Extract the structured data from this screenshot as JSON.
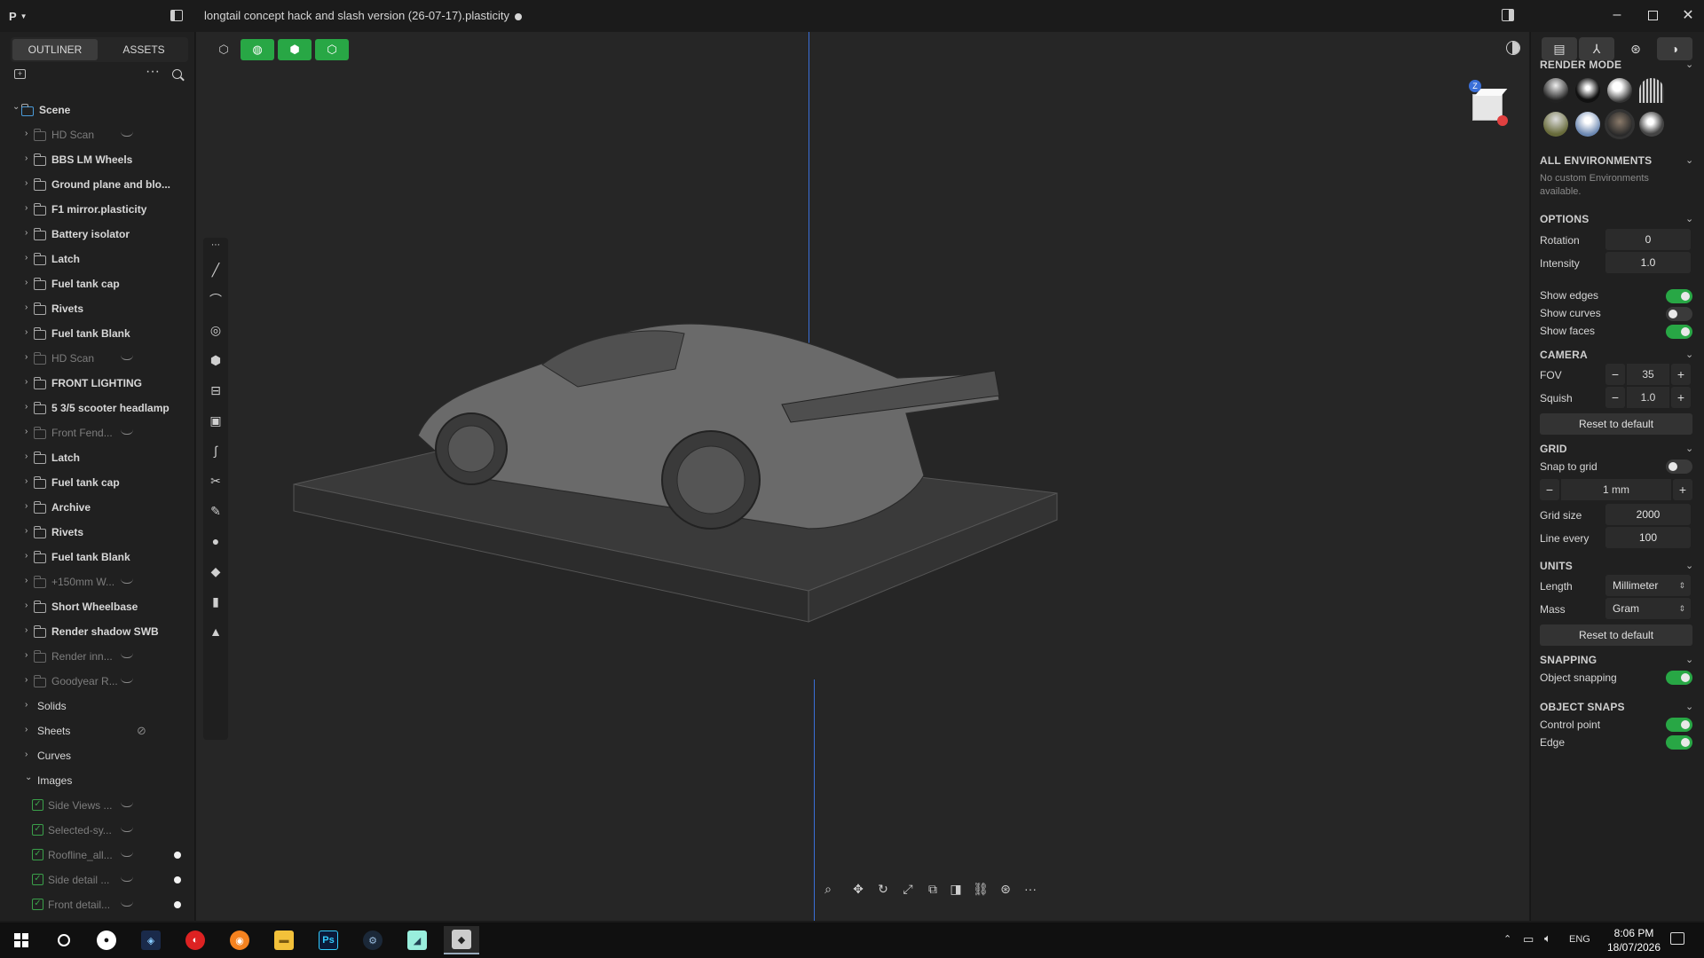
{
  "app": {
    "title": "longtail concept hack and slash version (26-07-17).plasticity",
    "menu_glyph": "P"
  },
  "outliner": {
    "tabs": [
      "OUTLINER",
      "ASSETS"
    ],
    "active_tab": "OUTLINER",
    "items": [
      {
        "label": "Scene",
        "level": 0,
        "expanded": true,
        "type": "folder",
        "dim": false
      },
      {
        "label": "HD Scan",
        "level": 1,
        "type": "folder",
        "dim": true,
        "hidden": true
      },
      {
        "label": "BBS LM Wheels",
        "level": 1,
        "type": "folder",
        "dim": false
      },
      {
        "label": "Ground plane and blo...",
        "level": 1,
        "type": "folder",
        "dim": false
      },
      {
        "label": "F1 mirror.plasticity",
        "level": 1,
        "type": "folder",
        "dim": false
      },
      {
        "label": "Battery isolator",
        "level": 1,
        "type": "folder",
        "dim": false
      },
      {
        "label": "Latch",
        "level": 1,
        "type": "folder",
        "dim": false
      },
      {
        "label": "Fuel tank cap",
        "level": 1,
        "type": "folder",
        "dim": false
      },
      {
        "label": "Rivets",
        "level": 1,
        "type": "folder",
        "dim": false
      },
      {
        "label": "Fuel tank Blank",
        "level": 1,
        "type": "folder",
        "dim": false
      },
      {
        "label": "HD Scan",
        "level": 1,
        "type": "folder",
        "dim": true,
        "hidden": true
      },
      {
        "label": "FRONT LIGHTING",
        "level": 1,
        "type": "folder",
        "dim": false
      },
      {
        "label": "5 3/5 scooter headlamp",
        "level": 1,
        "type": "folder",
        "dim": false
      },
      {
        "label": "Front Fend...",
        "level": 1,
        "type": "folder",
        "dim": true,
        "hidden": true
      },
      {
        "label": "Latch",
        "level": 1,
        "type": "folder",
        "dim": false
      },
      {
        "label": "Fuel tank cap",
        "level": 1,
        "type": "folder",
        "dim": false
      },
      {
        "label": "Archive",
        "level": 1,
        "type": "folder",
        "dim": false
      },
      {
        "label": "Rivets",
        "level": 1,
        "type": "folder",
        "dim": false
      },
      {
        "label": "Fuel tank Blank",
        "level": 1,
        "type": "folder",
        "dim": false
      },
      {
        "label": "+150mm W...",
        "level": 1,
        "type": "folder",
        "dim": true,
        "hidden": true
      },
      {
        "label": "Short Wheelbase",
        "level": 1,
        "type": "folder",
        "dim": false
      },
      {
        "label": "Render shadow SWB",
        "level": 1,
        "type": "folder",
        "dim": false
      },
      {
        "label": "Render inn...",
        "level": 1,
        "type": "folder",
        "dim": true,
        "hidden": true
      },
      {
        "label": "Goodyear R...",
        "level": 1,
        "type": "folder",
        "dim": true,
        "hidden": true
      },
      {
        "label": "Solids",
        "level": 1,
        "type": "group",
        "dim": false
      },
      {
        "label": "Sheets",
        "level": 1,
        "type": "group",
        "dim": false,
        "locked": true
      },
      {
        "label": "Curves",
        "level": 1,
        "type": "group",
        "dim": false
      },
      {
        "label": "Images",
        "level": 1,
        "type": "group",
        "dim": false,
        "expanded": true
      },
      {
        "label": "Side Views ...",
        "level": 2,
        "type": "image",
        "dim": true,
        "hidden": true
      },
      {
        "label": "Selected-sy...",
        "level": 2,
        "type": "image",
        "dim": true,
        "hidden": true
      },
      {
        "label": "Roofline_all...",
        "level": 2,
        "type": "image",
        "dim": true,
        "hidden": true,
        "dot": true
      },
      {
        "label": "Side detail ...",
        "level": 2,
        "type": "image",
        "dim": true,
        "hidden": true,
        "dot": true
      },
      {
        "label": "Front detail...",
        "level": 2,
        "type": "image",
        "dim": true,
        "hidden": true,
        "dot": true
      }
    ]
  },
  "viewport": {
    "axis_color": "#3a6fd8",
    "nav_cube_badge": "Z"
  },
  "right_panel": {
    "render_mode": {
      "title": "RENDER MODE"
    },
    "environments": {
      "title": "ALL ENVIRONMENTS",
      "empty_text": "No custom Environments available."
    },
    "options": {
      "title": "OPTIONS",
      "rotation_label": "Rotation",
      "rotation_value": "0",
      "intensity_label": "Intensity",
      "intensity_value": "1.0",
      "show_edges_label": "Show edges",
      "show_edges": true,
      "show_curves_label": "Show curves",
      "show_curves": false,
      "show_faces_label": "Show faces",
      "show_faces": true
    },
    "camera": {
      "title": "CAMERA",
      "fov_label": "FOV",
      "fov_value": "35",
      "squish_label": "Squish",
      "squish_value": "1.0",
      "reset_label": "Reset to default"
    },
    "grid": {
      "title": "GRID",
      "snap_label": "Snap to grid",
      "snap": false,
      "step_value": "1 mm",
      "size_label": "Grid size",
      "size_value": "2000",
      "line_every_label": "Line every",
      "line_every_value": "100"
    },
    "units": {
      "title": "UNITS",
      "length_label": "Length",
      "length_value": "Millimeter",
      "mass_label": "Mass",
      "mass_value": "Gram",
      "reset_label": "Reset to default"
    },
    "snapping": {
      "title": "SNAPPING",
      "object_snapping_label": "Object snapping",
      "object_snapping": true
    },
    "object_snaps": {
      "title": "OBJECT SNAPS",
      "control_point_label": "Control point",
      "control_point": true,
      "edge_label": "Edge",
      "edge": true
    }
  },
  "taskbar": {
    "language": "ENG",
    "time": "8:06 PM",
    "date": "18/07/2026",
    "ps_label": "Ps"
  },
  "colors": {
    "accent_green": "#28a745",
    "panel_bg": "#202020",
    "viewport_bg": "#262626"
  }
}
